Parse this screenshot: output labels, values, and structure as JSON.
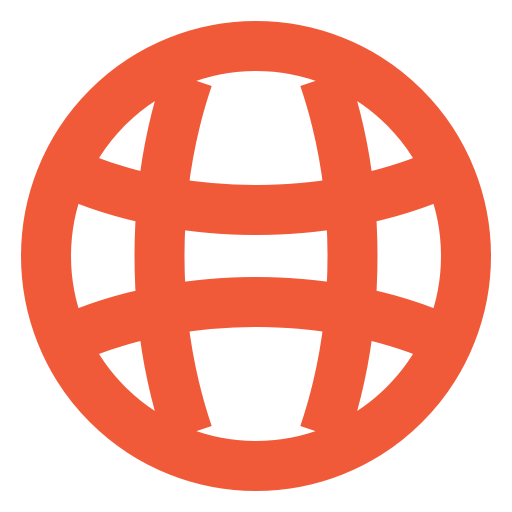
{
  "icon": {
    "name": "globe-icon",
    "color": "#F15A38",
    "background": "#FFFFFF"
  }
}
